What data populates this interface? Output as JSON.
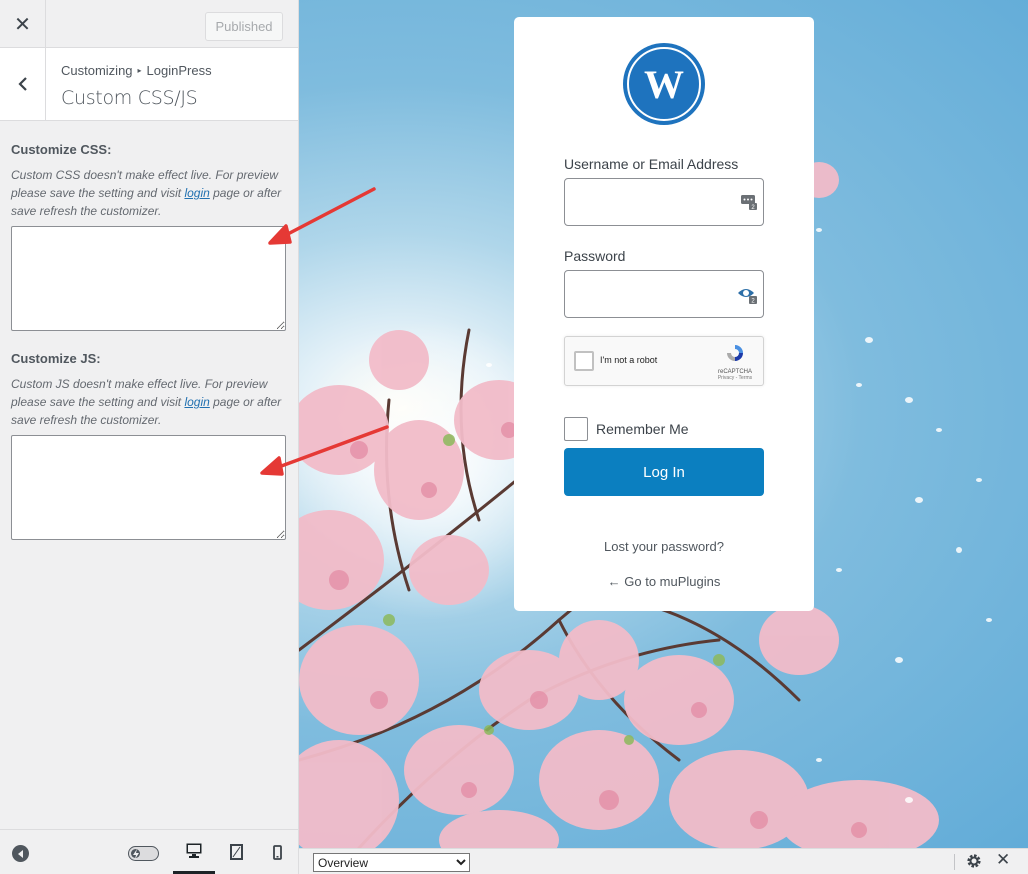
{
  "customizer": {
    "close_label": "✕",
    "publish_label": "Published",
    "breadcrumb": {
      "root": "Customizing",
      "separator": "▸",
      "section": "LoginPress"
    },
    "section_title": "Custom CSS/JS",
    "css": {
      "label": "Customize CSS:",
      "desc_before": "Custom CSS doesn't make effect live. For preview please save the setting and visit ",
      "link": "login",
      "desc_after": " page or after save refresh the customizer.",
      "value": ""
    },
    "js": {
      "label": "Customize JS:",
      "desc_before": "Custom JS doesn't make effect live. For preview please save the setting and visit ",
      "link": "login",
      "desc_after": " page or after save refresh the customizer.",
      "value": ""
    },
    "footer": {
      "icons": [
        "collapse-icon",
        "toggle-icon",
        "desktop-icon",
        "tablet-icon",
        "mobile-icon"
      ],
      "active_device": "desktop"
    }
  },
  "login": {
    "username_label": "Username or Email Address",
    "password_label": "Password",
    "captcha": {
      "text": "I'm not a robot",
      "brand": "reCAPTCHA",
      "links": "Privacy - Terms"
    },
    "remember_label": "Remember Me",
    "submit_label": "Log In",
    "lost_password": "Lost your password?",
    "back_link": "← Go to muPlugins",
    "button_color": "#0b7fc0",
    "logo": "wordpress-logo"
  },
  "devbar": {
    "select_value": "Overview",
    "options": [
      "Overview"
    ],
    "icons": [
      "gear-icon",
      "close-icon"
    ],
    "close_label": "✕"
  },
  "annotations": {
    "arrow_color": "#e53935",
    "count": 2
  }
}
